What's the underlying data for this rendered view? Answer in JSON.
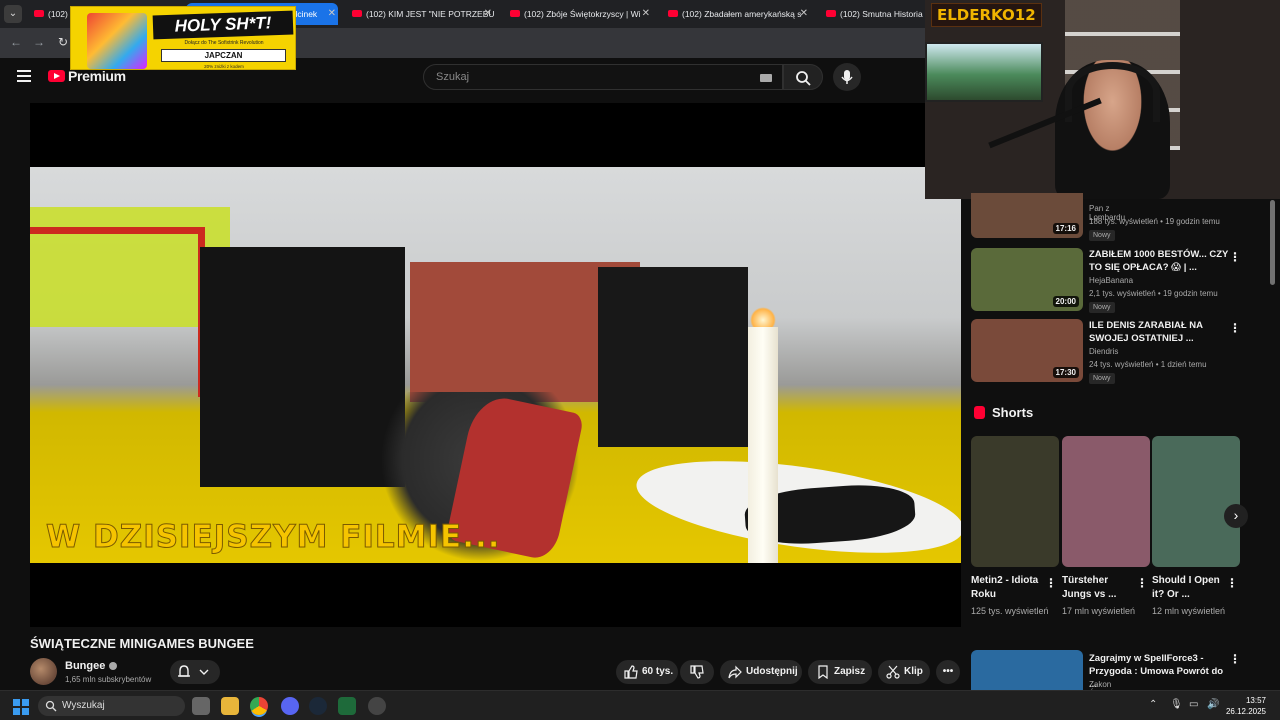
{
  "browser": {
    "tabs": [
      {
        "label": "(102) ŚWIĄTECZNE MINIGAMES",
        "active": false
      },
      {
        "label": "Odcinek",
        "active": true
      },
      {
        "label": "(102) KIM JEST \"NIE POTRZEBU",
        "active": false
      },
      {
        "label": "(102) Zbóje Świętokrzyscy | Wi",
        "active": false
      },
      {
        "label": "(102) Zbadałem amerykańską s",
        "active": false
      },
      {
        "label": "(102) Smutna Historia „W",
        "active": false
      }
    ]
  },
  "sponsor": {
    "headline": "HOLY SH*T!",
    "subline": "Dołącz do The Sofixtrink Revolution",
    "brand": "JAPCZAN",
    "code": "20% zniżki z kodem"
  },
  "header": {
    "logo_text": "Premium",
    "search_placeholder": "Szukaj"
  },
  "player": {
    "caption": "W DZISIEJSZYM FILMIE..."
  },
  "video": {
    "title": "ŚWIĄTECZNE MINIGAMES BUNGEE",
    "channel": "Bungee",
    "subscribers": "1,65 mln subskrybentów",
    "likes": "60 tys.",
    "share": "Udostępnij",
    "save": "Zapisz",
    "clip": "Klip"
  },
  "webcam": {
    "tag": "ELDERKO12"
  },
  "recommendations": [
    {
      "title": "",
      "channel": "Pan z Lombardu",
      "meta": "188 tys. wyświetleń • 19 godzin temu",
      "duration": "17:16",
      "badge": "Nowy",
      "color": "#6b4b3a"
    },
    {
      "title": "ZABIŁEM 1000 BESTÓW... CZY TO SIĘ OPŁACA? 😱 | ...",
      "channel": "HejaBanana",
      "meta": "2,1 tys. wyświetleń • 19 godzin temu",
      "duration": "20:00",
      "badge": "Nowy",
      "color": "#5a6a3a"
    },
    {
      "title": "ILE DENIS ZARABIAŁ NA SWOJEJ OSTATNIEJ ...",
      "channel": "Diendris",
      "meta": "24 tys. wyświetleń • 1 dzień temu",
      "duration": "17:30",
      "badge": "Nowy",
      "color": "#7a4a3a"
    },
    {
      "title": "Zagrajmy w SpellForce3 - Przygoda : Umowa  Powrót do ...",
      "channel": "Zakon Świtu",
      "meta": "",
      "duration": "",
      "badge": "",
      "color": "#2a6aa0"
    }
  ],
  "shorts": {
    "header": "Shorts",
    "items": [
      {
        "title": "Metin2 - Idiota Roku",
        "views": "125 tys. wyświetleń",
        "color": "#3a3a2a"
      },
      {
        "title": "Türsteher Jungs vs ...",
        "views": "17 mln wyświetleń",
        "color": "#8a5a6a"
      },
      {
        "title": "Should I Open it? Or ...",
        "views": "12 mln wyświetleń",
        "color": "#4a6a5a"
      }
    ]
  },
  "taskbar": {
    "search": "Wyszukaj",
    "time": "13:57",
    "date": "26.12.2025"
  }
}
